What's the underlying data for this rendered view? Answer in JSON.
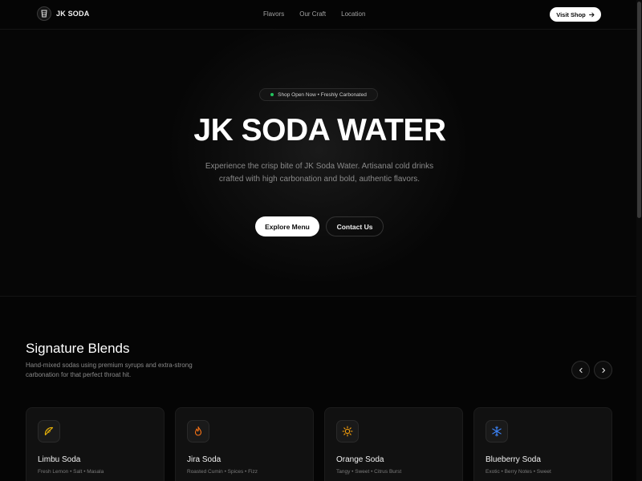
{
  "brand": {
    "name": "JK SODA"
  },
  "nav": {
    "links": [
      "Flavors",
      "Our Craft",
      "Location"
    ],
    "visit_label": "Visit Shop"
  },
  "hero": {
    "badge": "Shop Open Now • Freshly Carbonated",
    "title": "JK SODA WATER",
    "description": "Experience the crisp bite of JK Soda Water. Artisanal cold drinks crafted with high carbonation and bold, authentic flavors.",
    "primary_cta": "Explore Menu",
    "secondary_cta": "Contact Us"
  },
  "blends": {
    "title": "Signature Blends",
    "description": "Hand-mixed sodas using premium syrups and extra-strong carbonation for that perfect throat hit.",
    "cards": [
      {
        "name": "Limbu Soda",
        "tags": "Fresh Lemon • Salt • Masala",
        "icon": "lemon-icon",
        "icon_color": "#eab308"
      },
      {
        "name": "Jira Soda",
        "tags": "Roasted Cumin • Spices • Fizz",
        "icon": "flame-icon",
        "icon_color": "#f97316"
      },
      {
        "name": "Orange Soda",
        "tags": "Tangy • Sweet • Citrus Burst",
        "icon": "sun-icon",
        "icon_color": "#f59e0b"
      },
      {
        "name": "Blueberry Soda",
        "tags": "Exotic • Berry Notes • Sweet",
        "icon": "snowflake-icon",
        "icon_color": "#3b82f6"
      }
    ]
  },
  "colors": {
    "background": "#050505",
    "accent_green": "#22c55e"
  }
}
